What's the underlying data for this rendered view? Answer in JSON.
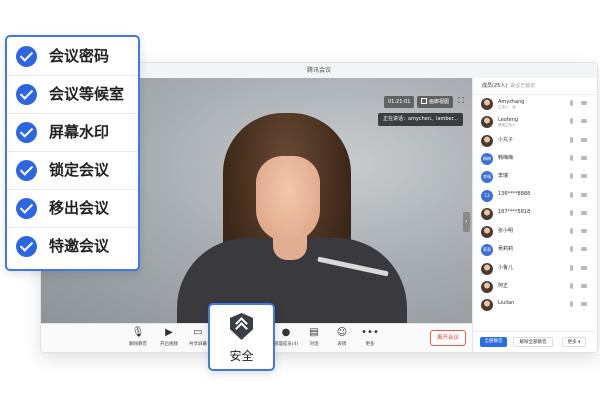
{
  "window": {
    "title": "腾讯会议"
  },
  "video": {
    "timer": "01:21:01",
    "gallery_label": "画廊视图",
    "speaking": "正在讲话：amychen、lamber..."
  },
  "toolbar": {
    "items": [
      "解除静音",
      "开启视频",
      "共享屏幕",
      "安全",
      "管理成员(4)",
      "对话",
      "表情",
      "更多"
    ],
    "leave_label": "离开会议"
  },
  "panel": {
    "title": "成员(25人)",
    "subtitle": "会议已锁定",
    "members": [
      {
        "name": "Amyzhang",
        "sub": "主持人、我",
        "avatar": "photo"
      },
      {
        "name": "Leofeng",
        "sub": "联席主持人",
        "avatar": "photo"
      },
      {
        "name": "小丸子",
        "sub": "",
        "avatar": "photo"
      },
      {
        "name": "韩梅梅",
        "sub": "",
        "avatar": "梅梅"
      },
      {
        "name": "李瑞",
        "sub": "",
        "avatar": "李瑞"
      },
      {
        "name": "136****8888",
        "sub": "",
        "avatar": "13"
      },
      {
        "name": "187****5818",
        "sub": "",
        "avatar": "photo"
      },
      {
        "name": "张小明",
        "sub": "",
        "avatar": "photo"
      },
      {
        "name": "吴莉莉",
        "sub": "",
        "avatar": "莉莉"
      },
      {
        "name": "小鲁儿",
        "sub": "",
        "avatar": "photo"
      },
      {
        "name": "阿正",
        "sub": "",
        "avatar": "photo"
      },
      {
        "name": "Liulian",
        "sub": "",
        "avatar": "photo"
      }
    ],
    "footer": {
      "mute_all": "全部静音",
      "unmute_all": "解除全部静音",
      "more": "更多 ▾"
    }
  },
  "security_menu": {
    "items": [
      "会议密码",
      "会议等候室",
      "屏幕水印",
      "锁定会议",
      "移出会议",
      "特邀会议"
    ]
  },
  "security_button": {
    "label": "安全"
  },
  "colors": {
    "accent": "#2d66e0",
    "danger": "#e5443a"
  }
}
